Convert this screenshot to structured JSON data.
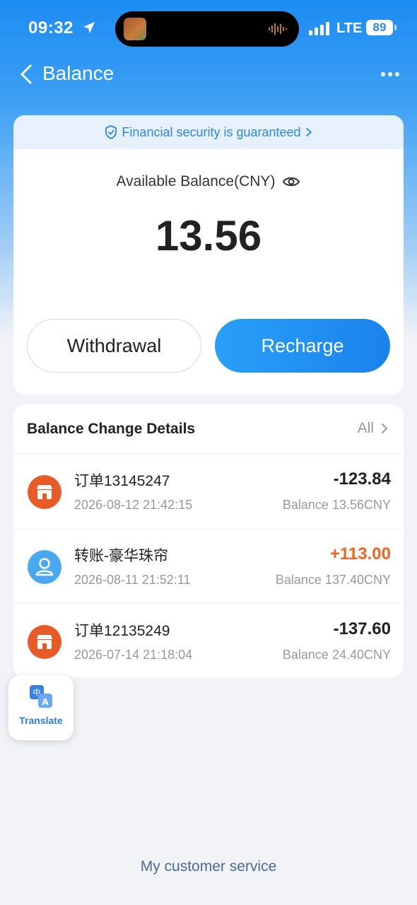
{
  "status_bar": {
    "time": "09:32",
    "network": "LTE",
    "battery": "89"
  },
  "nav": {
    "title": "Balance"
  },
  "security": {
    "text": "Financial security is guaranteed"
  },
  "balance": {
    "label": "Available Balance(CNY)",
    "amount": "13.56"
  },
  "actions": {
    "withdraw": "Withdrawal",
    "recharge": "Recharge"
  },
  "details": {
    "title": "Balance Change Details",
    "all_label": "All",
    "transactions": [
      {
        "name": "订单13145247",
        "time": "2026-08-12 21:42:15",
        "amount": "-123.84",
        "balance": "Balance 13.56CNY",
        "icon": "shop-icon",
        "color": "#e85a26"
      },
      {
        "name": "转账-豪华珠帘",
        "time": "2026-08-11 21:52:11",
        "amount": "+113.00",
        "balance": "Balance 137.40CNY",
        "icon": "user-icon",
        "color": "#4aa8f0"
      },
      {
        "name": "订单12135249",
        "time": "2026-07-14 21:18:04",
        "amount": "-137.60",
        "balance": "Balance 24.40CNY",
        "icon": "shop-icon",
        "color": "#e85a26"
      }
    ]
  },
  "translate": {
    "label": "Translate"
  },
  "footer": {
    "customer_service": "My customer service"
  },
  "colors": {
    "primary": "#1a82ec",
    "positive_amount": "#f26522",
    "security_text": "#2f86e6"
  }
}
